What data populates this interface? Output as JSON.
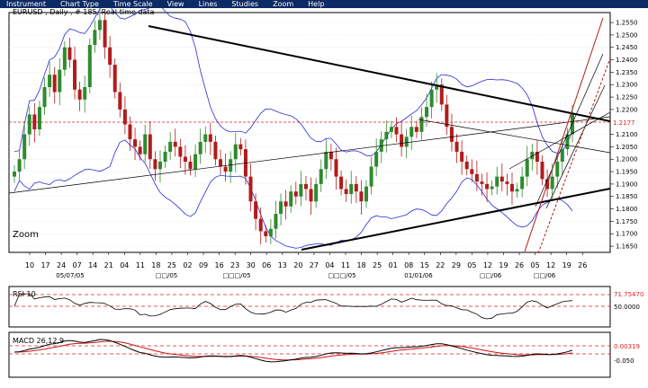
{
  "menu": [
    "Instrument",
    "Chart Type",
    "Time Scale",
    "View",
    "Lines",
    "Studies",
    "Zoom",
    "Help"
  ],
  "colors": {
    "menubar_bg": "#0c2a63",
    "up_candle": "#2f8a2f",
    "down_candle": "#b01c1c",
    "bollinger": "#2b2bd6",
    "trendline": "#000000",
    "current_price": "#e02020",
    "rsi_line": "#000000",
    "macd_line": "#000000",
    "macd_signal": "#cc1515"
  },
  "main_panel": {
    "title": "EURUSD , Daily , # 185, Real-time data",
    "zoom_label": "Zoom",
    "current_price_label": "1.2177",
    "y_ticks": [
      "1.2550",
      "1.2500",
      "1.2450",
      "1.2400",
      "1.2350",
      "1.2300",
      "1.2250",
      "1.2200",
      "1.2100",
      "1.2050",
      "1.2000",
      "1.1950",
      "1.1900",
      "1.1850",
      "1.1800",
      "1.1750",
      "1.1700",
      "1.1650"
    ],
    "x_day_labels": [
      "10",
      "17",
      "24",
      "07",
      "14",
      "21",
      "04",
      "11",
      "18",
      "25",
      "02",
      "09",
      "16",
      "23",
      "30",
      "06",
      "13",
      "20",
      "27",
      "04",
      "11",
      "18",
      "25",
      "01",
      "08",
      "15",
      "22",
      "29",
      "05",
      "12",
      "19",
      "26",
      "05",
      "12",
      "19",
      "26"
    ],
    "x_month_labels": [
      "05/07/05",
      "□□/05",
      "□□□/05",
      "□□□/05",
      "01/01/06",
      "□□/06",
      "□□/06"
    ]
  },
  "rsi_panel": {
    "title": "RSI 10",
    "level_high": "71.75470",
    "level_mid": "50.0000"
  },
  "macd_panel": {
    "title": "MACD 26,12,9",
    "value": "0.00319",
    "level": "-0.050"
  },
  "chart_data": [
    {
      "type": "candlestick",
      "title": "EURUSD , Daily , # 185, Real-time data",
      "ylim": [
        1.1625,
        1.259
      ],
      "closes": [
        1.195,
        1.2,
        1.21,
        1.218,
        1.212,
        1.221,
        1.229,
        1.234,
        1.227,
        1.236,
        1.245,
        1.24,
        1.228,
        1.224,
        1.229,
        1.246,
        1.252,
        1.256,
        1.245,
        1.238,
        1.227,
        1.22,
        1.214,
        1.208,
        1.205,
        1.202,
        1.21,
        1.2,
        1.196,
        1.199,
        1.203,
        1.207,
        1.205,
        1.201,
        1.199,
        1.196,
        1.202,
        1.207,
        1.21,
        1.207,
        1.2,
        1.197,
        1.195,
        1.2,
        1.206,
        1.204,
        1.193,
        1.183,
        1.176,
        1.171,
        1.169,
        1.172,
        1.178,
        1.183,
        1.181,
        1.187,
        1.185,
        1.19,
        1.188,
        1.183,
        1.19,
        1.196,
        1.203,
        1.2,
        1.193,
        1.188,
        1.186,
        1.19,
        1.187,
        1.183,
        1.189,
        1.197,
        1.203,
        1.208,
        1.211,
        1.213,
        1.21,
        1.205,
        1.209,
        1.213,
        1.211,
        1.217,
        1.221,
        1.228,
        1.23,
        1.222,
        1.213,
        1.207,
        1.203,
        1.199,
        1.196,
        1.194,
        1.191,
        1.19,
        1.188,
        1.189,
        1.193,
        1.191,
        1.19,
        1.187,
        1.188,
        1.193,
        1.2,
        1.203,
        1.199,
        1.192,
        1.188,
        1.193,
        1.199,
        1.204,
        1.21,
        1.218
      ]
    },
    {
      "type": "line",
      "title": "RSI 10",
      "levels": [
        71.7547,
        50.0
      ]
    },
    {
      "type": "line",
      "title": "MACD 26,12,9",
      "series": [
        {
          "name": "MACD"
        },
        {
          "name": "Signal"
        }
      ],
      "levels": [
        0.00319,
        -0.05
      ]
    }
  ]
}
